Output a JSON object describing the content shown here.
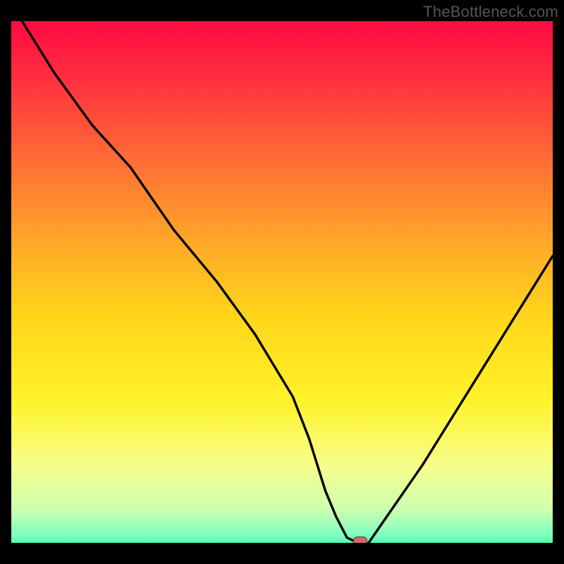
{
  "watermark": "TheBottleneck.com",
  "chart_data": {
    "type": "line",
    "title": "",
    "xlabel": "",
    "ylabel": "",
    "xlim": [
      0,
      100
    ],
    "ylim": [
      0,
      100
    ],
    "grid": false,
    "series": [
      {
        "name": "bottleneck-curve",
        "x": [
          2,
          8,
          15,
          22,
          30,
          38,
          45,
          52,
          55,
          58,
          60,
          62,
          64,
          66,
          70,
          76,
          82,
          88,
          94,
          100
        ],
        "values": [
          100,
          90,
          80,
          72,
          60,
          50,
          40,
          28,
          20,
          10,
          5,
          1,
          0,
          0,
          6,
          15,
          25,
          35,
          45,
          55
        ]
      }
    ],
    "marker": {
      "x": 64.5,
      "y": 0
    },
    "background_gradient": {
      "stops": [
        {
          "offset": 0,
          "color": "#ff0a42"
        },
        {
          "offset": 0.1,
          "color": "#ff2d3f"
        },
        {
          "offset": 0.25,
          "color": "#ff6a36"
        },
        {
          "offset": 0.4,
          "color": "#ffa529"
        },
        {
          "offset": 0.55,
          "color": "#ffd71a"
        },
        {
          "offset": 0.7,
          "color": "#fff22a"
        },
        {
          "offset": 0.82,
          "color": "#f6ff8a"
        },
        {
          "offset": 0.9,
          "color": "#d0ffb0"
        },
        {
          "offset": 0.95,
          "color": "#7dffc0"
        },
        {
          "offset": 0.975,
          "color": "#2aff9f"
        },
        {
          "offset": 1.0,
          "color": "#0de07a"
        }
      ]
    }
  },
  "colors": {
    "curve": "#000000",
    "marker_fill": "#cf6a66",
    "marker_border": "#7a2d2a",
    "frame_bg": "#000000",
    "watermark": "#555555"
  }
}
